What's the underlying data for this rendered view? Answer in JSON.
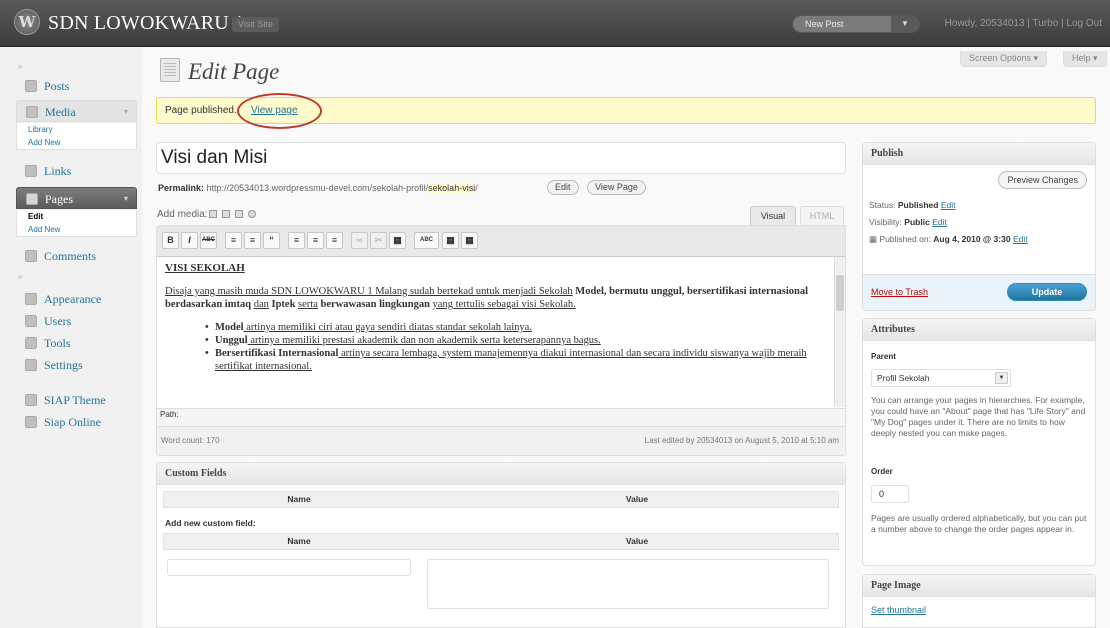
{
  "header": {
    "logo": "W",
    "site_title": "SDN LOWOKWARU 1",
    "visit_site": "Visit Site",
    "new_post": "New Post",
    "user_links": "Howdy, 20534013 | Turbo | Log Out"
  },
  "screen_options": "Screen Options ▾",
  "help": "Help ▾",
  "sidebar": {
    "items": [
      {
        "label": "Posts",
        "icon": "pin-icon"
      },
      {
        "label": "Media",
        "icon": "media-icon"
      },
      {
        "label": "Links",
        "icon": "links-icon"
      },
      {
        "label": "Pages",
        "icon": "pages-icon"
      },
      {
        "label": "Comments",
        "icon": "comments-icon"
      },
      {
        "label": "Appearance",
        "icon": "appearance-icon"
      },
      {
        "label": "Users",
        "icon": "users-icon"
      },
      {
        "label": "Tools",
        "icon": "tools-icon"
      },
      {
        "label": "Settings",
        "icon": "settings-icon"
      },
      {
        "label": "SIAP Theme",
        "icon": "theme-icon"
      },
      {
        "label": "Siap Online",
        "icon": "online-icon"
      }
    ],
    "media_sub": [
      "Library",
      "Add New"
    ],
    "pages_sub": [
      "Edit",
      "Add New"
    ]
  },
  "main": {
    "title": "Edit Page",
    "notice_text": "Page published.",
    "notice_link": "View page",
    "post_title": "Visi dan Misi",
    "permalink_label": "Permalink:",
    "permalink_url": "http://20534013.wordpressmu-devel.com/sekolah-profil/",
    "permalink_slug": "sekolah-visi",
    "edit_btn": "Edit",
    "view_page_btn": "View Page",
    "add_media": "Add media:",
    "visual_tab": "Visual",
    "html_tab": "HTML",
    "toolbar": [
      "B",
      "I",
      "ABC",
      "≡",
      "≡",
      "“",
      "≡",
      "≡",
      "≡",
      "∞",
      "✂",
      "▦",
      "ABC",
      "▦",
      "▦"
    ],
    "content": {
      "heading": "VISI SEKOLAH",
      "para_start": "Disaja yang masih muda SDN LOWOKWARU 1 Malang sudah bertekad untuk menjadi Sekolah",
      "para_bold1": "Model, bermutu unggul, bersertifikasi internasional berdasarkan imtaq",
      "para_mid": "dan",
      "para_bold2": "Iptek",
      "para_mid2": "serta",
      "para_bold3": "berwawasan lingkungan",
      "para_end": "yang tertulis sebagai visi Sekolah.",
      "bullets": [
        {
          "bold": "Model",
          "text": " artinya memiliki ciri atau gaya sendiri diatas standar sekolah lainya."
        },
        {
          "bold": "Unggul",
          "text": " artinya memiliki prestasi akademik dan non akademik serta keterserapannya bagus."
        },
        {
          "bold": "Bersertifikasi Internasional",
          "text": " artinya secara lembaga, system manajemennya diakui internasional dan secara individu siswanya wajib meraih sertifikat internasional."
        }
      ]
    },
    "path": "Path:",
    "word_count": "Word count: 170",
    "last_edited": "Last edited by 20534013 on August 5, 2010 at 5:10 am"
  },
  "custom_fields": {
    "title": "Custom Fields",
    "col_name": "Name",
    "col_value": "Value",
    "add_new": "Add new custom field:"
  },
  "publish": {
    "title": "Publish",
    "preview": "Preview Changes",
    "status_label": "Status:",
    "status_value": "Published",
    "visibility_label": "Visibility:",
    "visibility_value": "Public",
    "published_label": "Published on:",
    "published_value": "Aug 4, 2010 @ 3:30",
    "edit": "Edit",
    "trash": "Move to Trash",
    "update": "Update"
  },
  "attributes": {
    "title": "Attributes",
    "parent_label": "Parent",
    "parent_value": "Profil Sekolah",
    "parent_help": "You can arrange your pages in hierarchies. For example, you could have an \"About\" page that has \"Life Story\" and \"My Dog\" pages under it. There are no limits to how deeply nested you can make pages.",
    "order_label": "Order",
    "order_value": "0",
    "order_help": "Pages are usually ordered alphabetically, but you can put a number above to change the order pages appear in."
  },
  "page_image": {
    "title": "Page Image",
    "set_thumbnail": "Set thumbnail"
  }
}
